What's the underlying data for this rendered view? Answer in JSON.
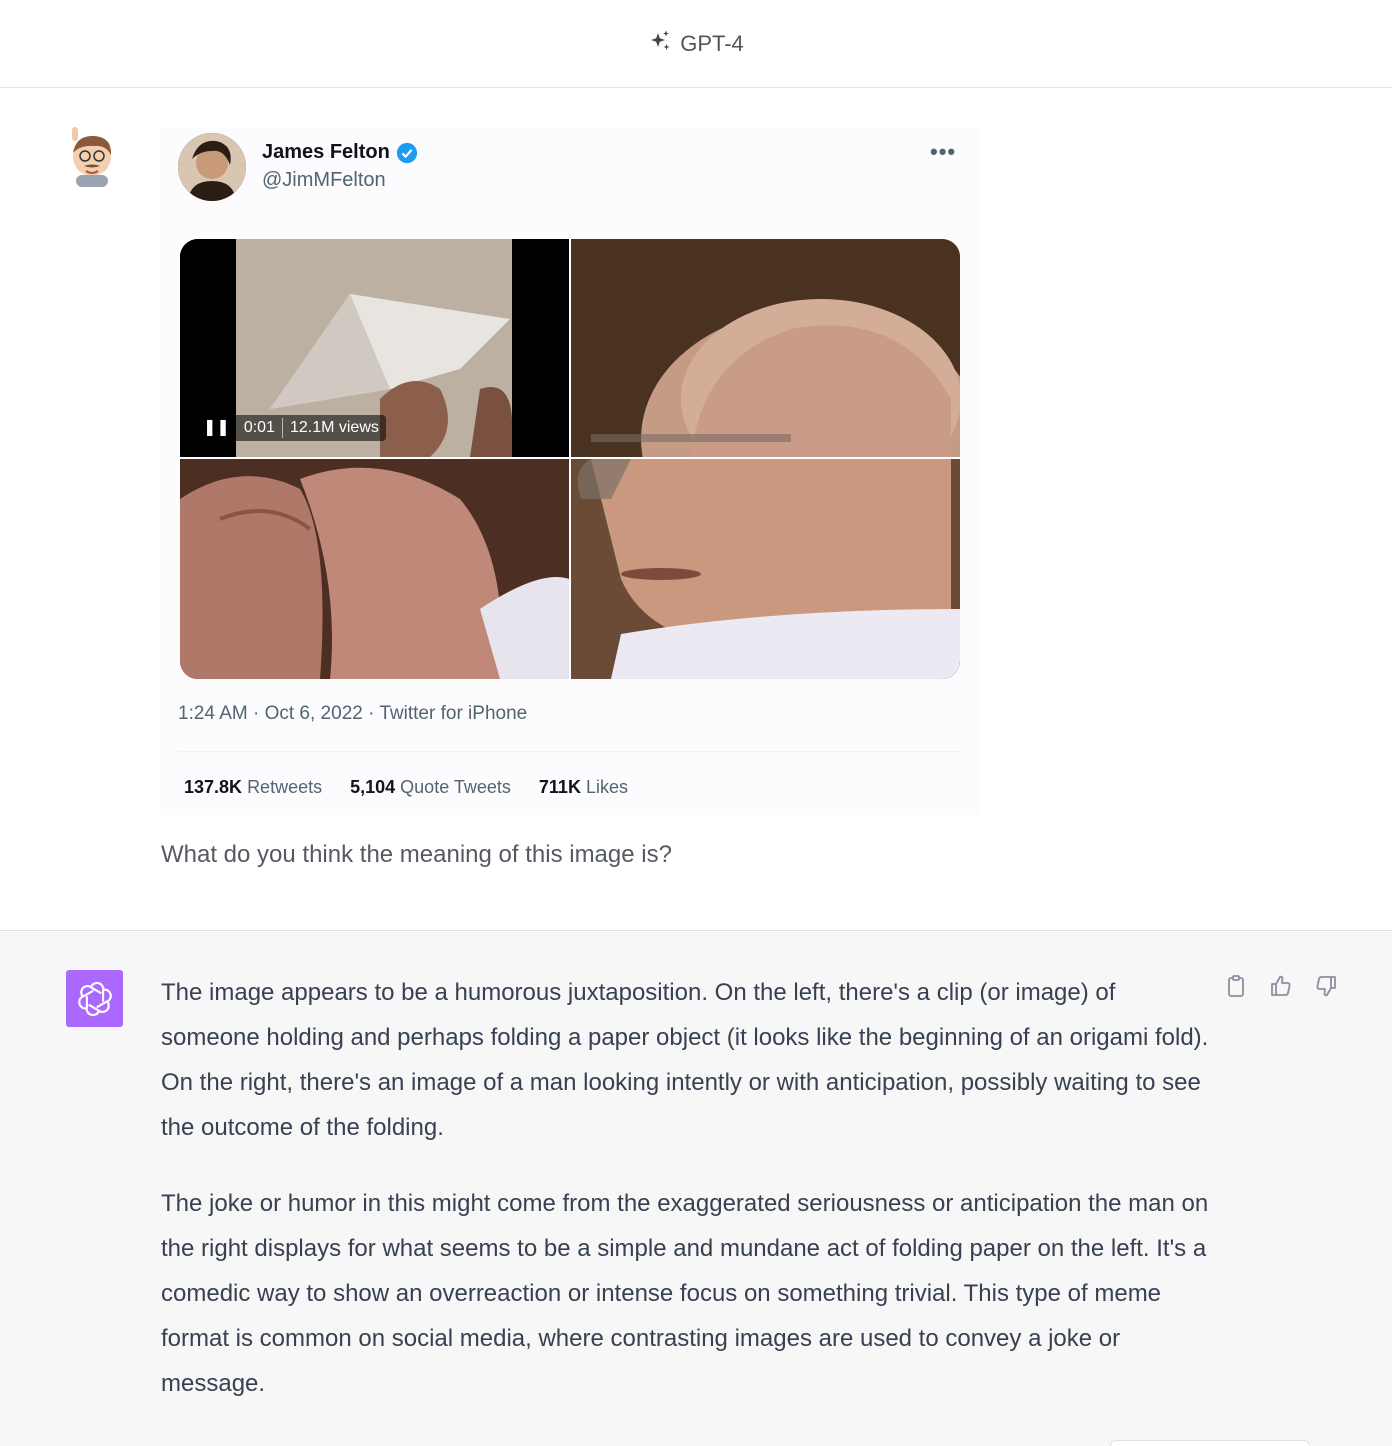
{
  "header": {
    "model_name": "GPT-4",
    "icon": "sparkles-icon"
  },
  "user_message": {
    "avatar": "memoji-avatar",
    "tweet": {
      "author_name": "James Felton",
      "verified_icon": "verified-badge-icon",
      "handle": "@JimMFelton",
      "more_icon": "more-dots-icon",
      "video_time": "0:01",
      "video_views": "12.1M views",
      "timestamp": "1:24 AM · Oct 6, 2022 · Twitter for iPhone",
      "stats": [
        {
          "value": "137.8K",
          "label": "Retweets"
        },
        {
          "value": "5,104",
          "label": "Quote Tweets"
        },
        {
          "value": "711K",
          "label": "Likes"
        }
      ]
    },
    "text": "What do you think the meaning of this image is?"
  },
  "assistant_message": {
    "avatar_color": "#ab68ff",
    "paragraphs": [
      "The image appears to be a humorous juxtaposition. On the left, there's a clip (or image) of someone holding and perhaps folding a paper object (it looks like the beginning of an origami fold). On the right, there's an image of a man looking intently or with anticipation, possibly waiting to see the outcome of the folding.",
      "The joke or humor in this might come from the exaggerated seriousness or anticipation the man on the right displays for what seems to be a simple and mundane act of folding paper on the left. It's a comedic way to show an overreaction or intense focus on something trivial. This type of meme format is common on social media, where contrasting images are used to convey a joke or message."
    ],
    "actions": [
      "copy-icon",
      "thumbs-up-icon",
      "thumbs-down-icon"
    ]
  }
}
